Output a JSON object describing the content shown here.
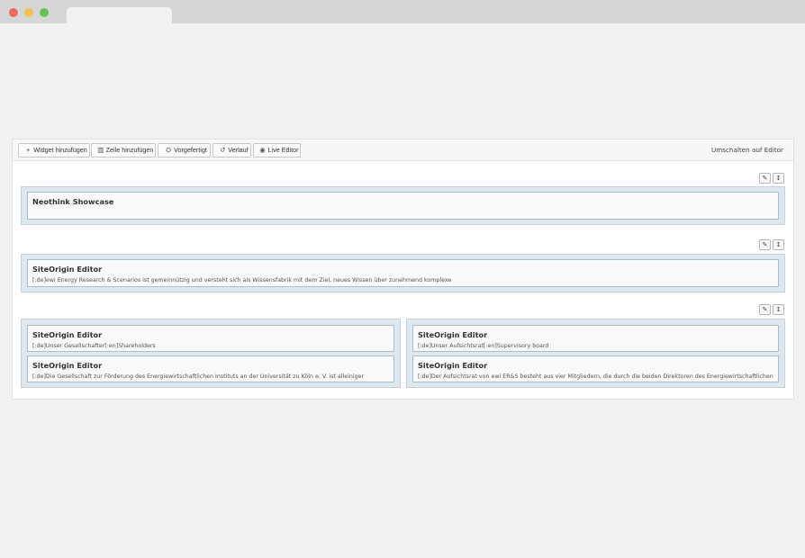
{
  "toolbar": {
    "buttons": [
      {
        "icon": "+",
        "label": "Widget hinzufügen"
      },
      {
        "icon": "▥",
        "label": "Zeile hinzufügen"
      },
      {
        "icon": "⛭",
        "label": "Vorgefertigt"
      },
      {
        "icon": "↺",
        "label": "Verlauf"
      },
      {
        "icon": "◉",
        "label": "Live Editor"
      }
    ],
    "switch_label": "Umschalten auf Editor"
  },
  "row_tools": {
    "wrench_glyph": "✎",
    "move_glyph": "↕"
  },
  "rows": [
    {
      "widgets": [
        {
          "title": "Neothink Showcase",
          "description": ""
        }
      ]
    },
    {
      "widgets": [
        {
          "title": "SiteOrigin Editor",
          "description": "[:de]ewi Energy Research & Scenarios ist gemeinnützig und versteht sich als Wissensfabrik mit dem Ziel, neues Wissen über zunehmend komplexe"
        }
      ]
    },
    {
      "cells": [
        {
          "widgets": [
            {
              "title": "SiteOrigin Editor",
              "description": "[:de]Unser Gesellschafter[:en]Shareholders"
            },
            {
              "title": "SiteOrigin Editor",
              "description": "[:de]Die Gesellschaft zur Förderung des Energiewirtschaftlichen Instituts an der Universität zu Köln e. V. ist alleiniger"
            }
          ]
        },
        {
          "widgets": [
            {
              "title": "SiteOrigin Editor",
              "description": "[:de]Unser Aufsichtsrat[:en]Supervisory board"
            },
            {
              "title": "SiteOrigin Editor",
              "description": "[:de]Der Aufsichtsrat von ewi ER&S besteht aus vier Mitgliedern, die durch die beiden Direktoren des Energiewirtschaftlichen"
            }
          ]
        }
      ]
    }
  ]
}
